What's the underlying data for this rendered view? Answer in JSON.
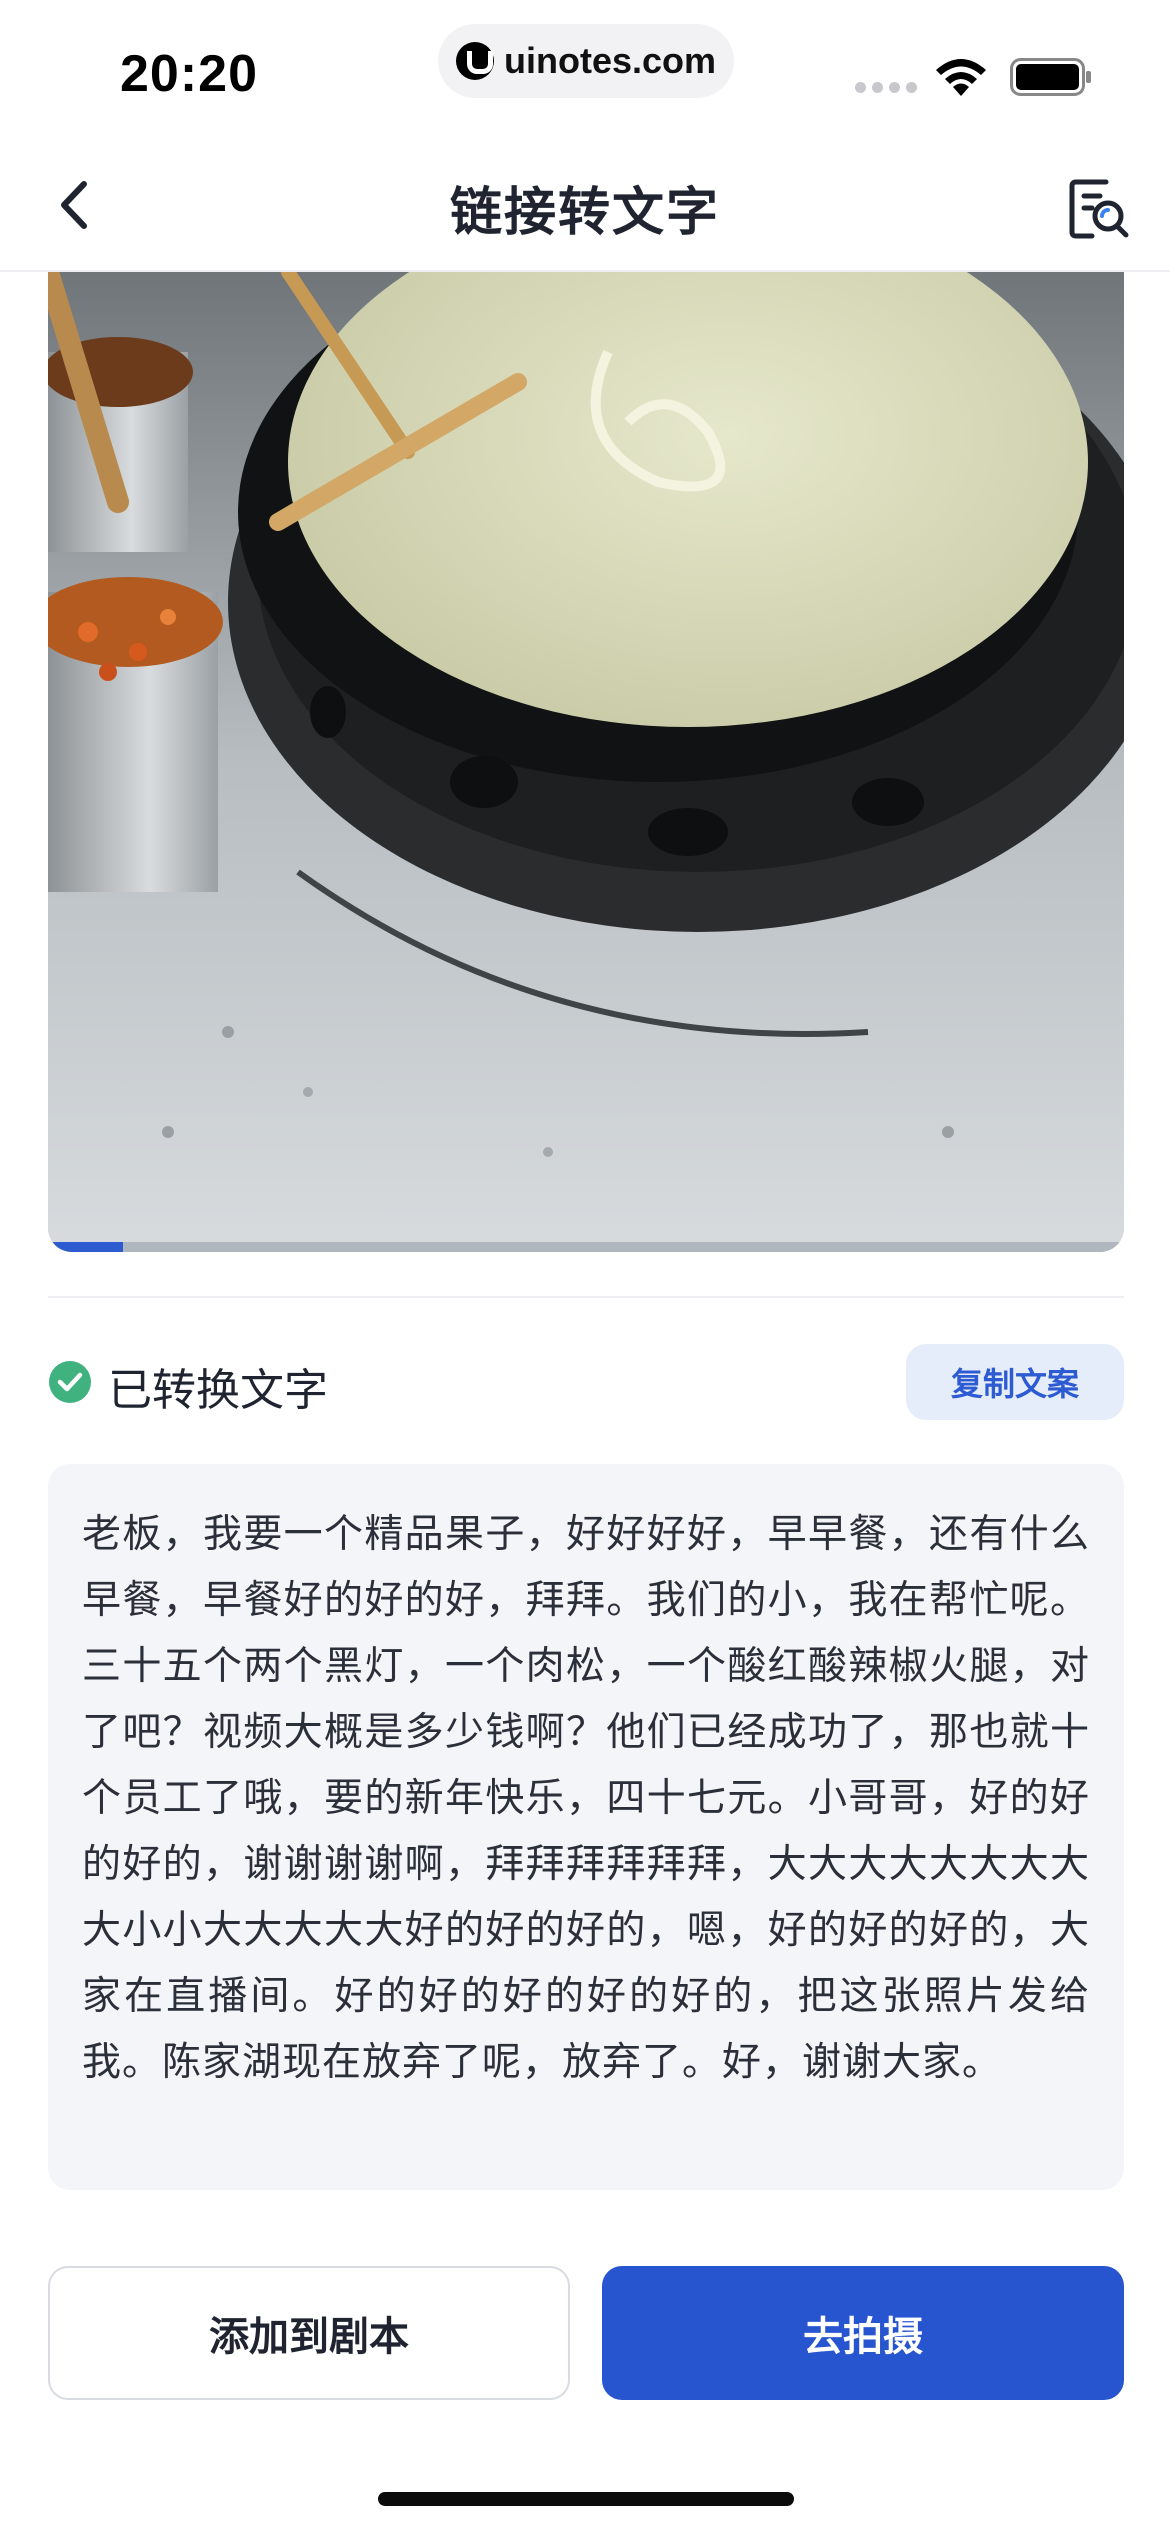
{
  "status_bar": {
    "time": "20:20",
    "url": "uinotes.com"
  },
  "nav": {
    "title": "链接转文字"
  },
  "video": {
    "progress": 0.07,
    "accent_color": "#2f5bd1"
  },
  "result": {
    "status_label": "已转换文字",
    "copy_label": "复制文案",
    "transcript": "老板，我要一个精品果子，好好好好，早早餐，还有什么早餐，早餐好的好的好，拜拜。我们的小，我在帮忙呢。三十五个两个黑灯，一个肉松，一个酸红酸辣椒火腿，对了吧？视频大概是多少钱啊？他们已经成功了，那也就十个员工了哦，要的新年快乐，四十七元。小哥哥，好的好的好的，谢谢谢谢啊，拜拜拜拜拜拜，大大大大大大大大大小小大大大大大好的好的好的，嗯，好的好的好的，大家在直播间。好的好的好的好的好的，把这张照片发给我。陈家湖现在放弃了呢，放弃了。好，谢谢大家。"
  },
  "actions": {
    "add_label": "添加到剧本",
    "shoot_label": "去拍摄",
    "primary_color": "#2754cf"
  }
}
